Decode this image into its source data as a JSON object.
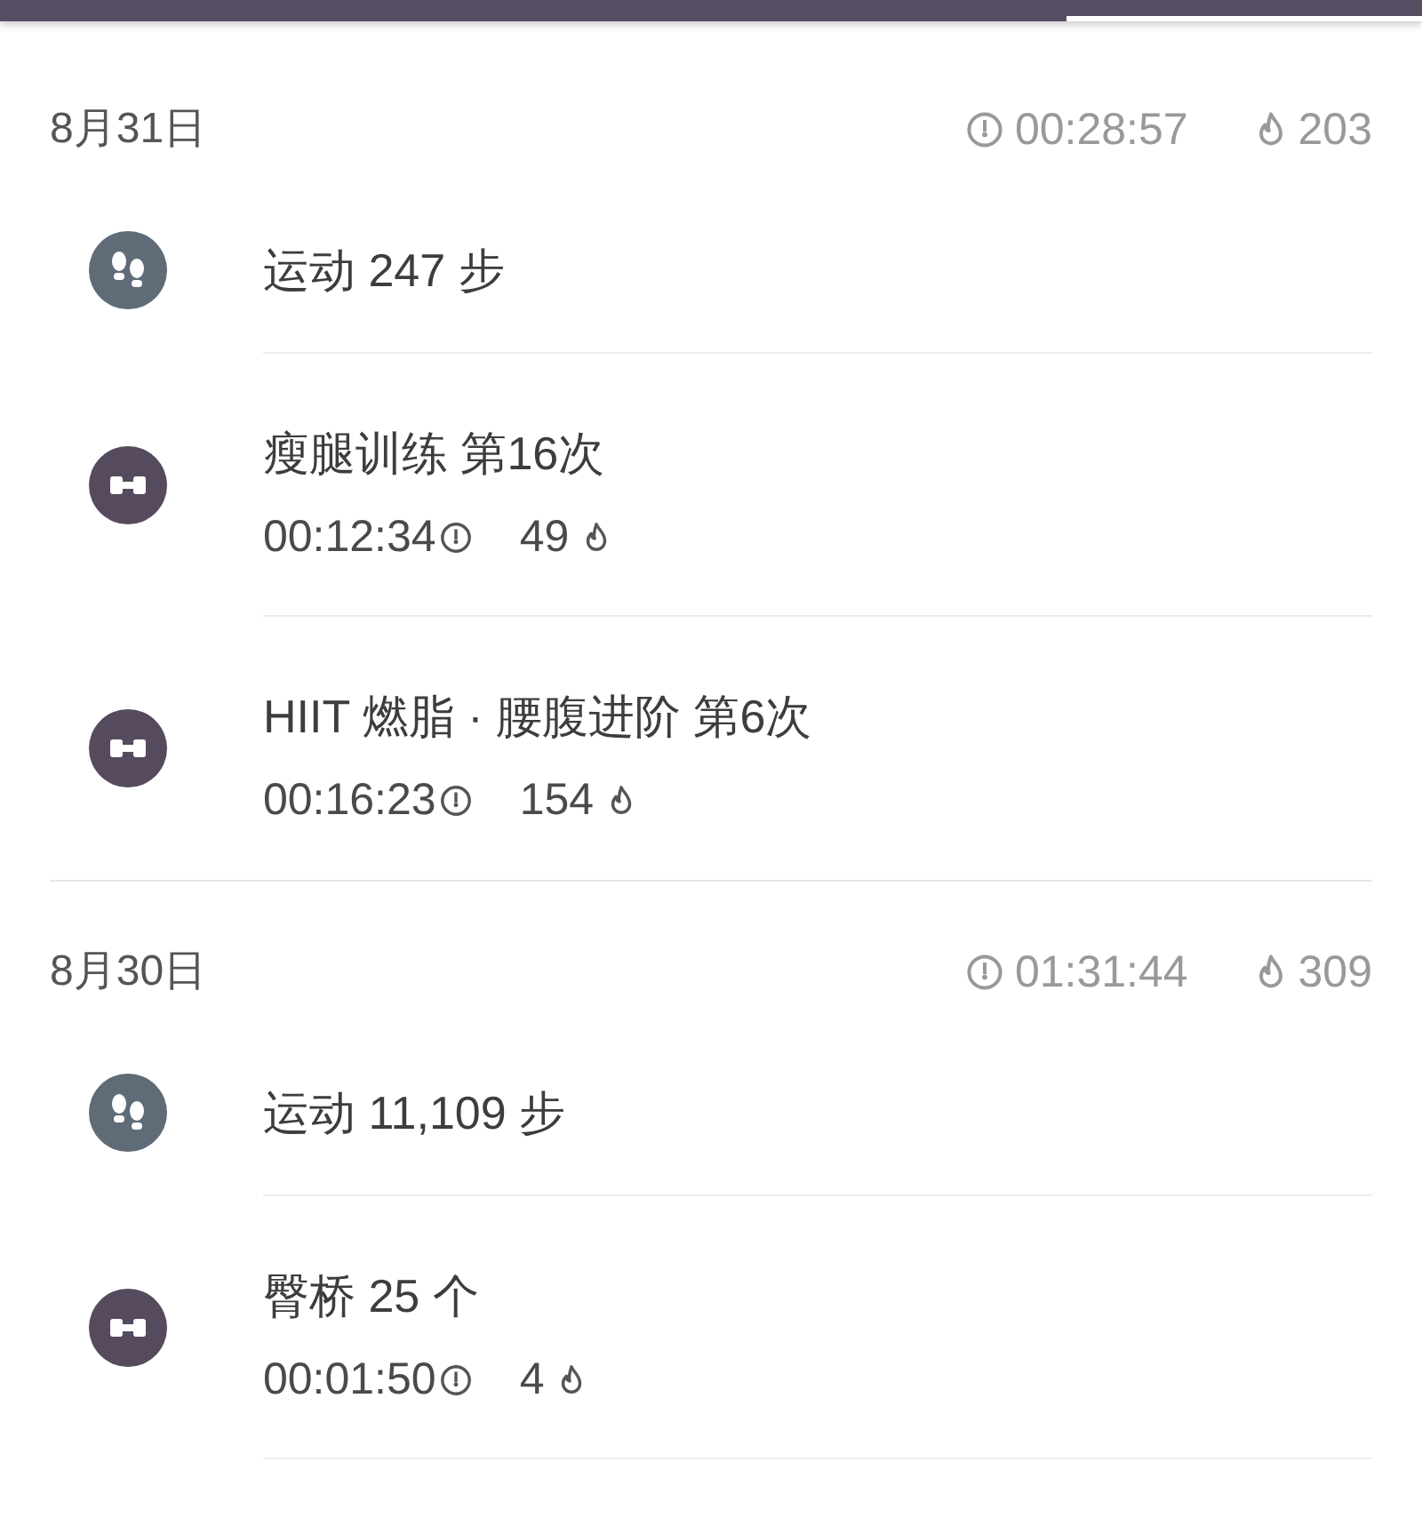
{
  "tabs": [
    {
      "selected": false
    },
    {
      "selected": false
    },
    {
      "selected": false
    },
    {
      "selected": true
    }
  ],
  "days": [
    {
      "date": "8月31日",
      "duration": "00:28:57",
      "calories": "203",
      "items": [
        {
          "kind": "steps",
          "title": "运动 247 步"
        },
        {
          "kind": "workout",
          "title": "瘦腿训练 第16次",
          "duration": "00:12:34",
          "calories": "49"
        },
        {
          "kind": "workout",
          "title": "HIIT 燃脂 · 腰腹进阶 第6次",
          "duration": "00:16:23",
          "calories": "154"
        }
      ]
    },
    {
      "date": "8月30日",
      "duration": "01:31:44",
      "calories": "309",
      "items": [
        {
          "kind": "steps",
          "title": "运动 11,109 步"
        },
        {
          "kind": "workout",
          "title": "臀桥 25 个",
          "duration": "00:01:50",
          "calories": "4"
        }
      ]
    }
  ]
}
